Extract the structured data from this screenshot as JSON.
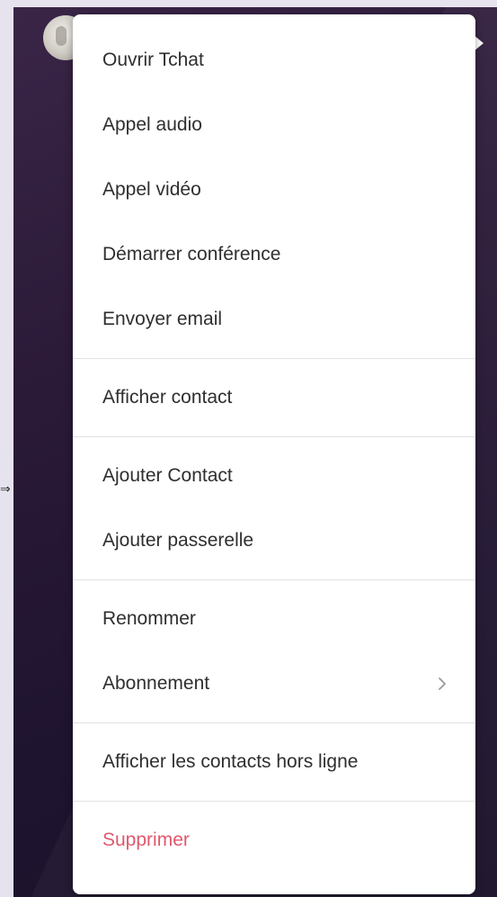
{
  "menu": {
    "groups": [
      {
        "items": [
          {
            "label": "Ouvrir Tchat"
          },
          {
            "label": "Appel audio"
          },
          {
            "label": "Appel vidéo"
          },
          {
            "label": "Démarrer conférence"
          },
          {
            "label": "Envoyer email"
          }
        ]
      },
      {
        "items": [
          {
            "label": "Afficher contact"
          }
        ]
      },
      {
        "items": [
          {
            "label": "Ajouter Contact"
          },
          {
            "label": "Ajouter passerelle"
          }
        ]
      },
      {
        "items": [
          {
            "label": "Renommer"
          },
          {
            "label": "Abonnement",
            "icon": "chevron-right-icon"
          }
        ]
      },
      {
        "items": [
          {
            "label": "Afficher les contacts hors ligne"
          }
        ]
      },
      {
        "items": [
          {
            "label": "Supprimer",
            "color": "#e0596d"
          }
        ]
      }
    ]
  },
  "colors": {
    "panel_background": "#2b1a38",
    "menu_background": "#ffffff",
    "danger": "#e0596d",
    "text": "#2f2f2f"
  },
  "icons": {
    "collapse_arrow": "⇒"
  }
}
